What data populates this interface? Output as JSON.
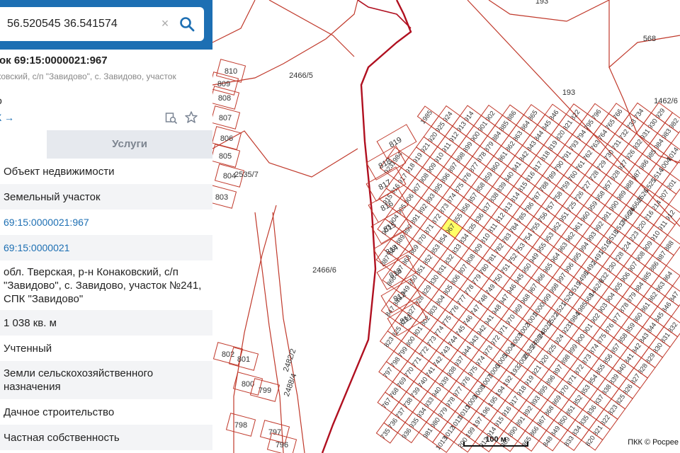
{
  "search": {
    "value": "56.520545 36.541574",
    "placeholder": "",
    "clear_glyph": "×",
    "icon": "search-icon"
  },
  "panel": {
    "title": "ок 69:15:0000021:967",
    "subtitle": "ковский, с/п \"Завидово\", с. Завидово, участок",
    "line3": "о",
    "link_label": "К →",
    "icons": [
      "document-search-icon",
      "star-icon"
    ],
    "collapse_glyph": "‹"
  },
  "tabs": {
    "info_label": "",
    "services_label": "Услуги"
  },
  "attributes": [
    "Объект недвижимости",
    "Земельный участок",
    "69:15:0000021:967",
    "69:15:0000021",
    "обл. Тверская, р-н Конаковский, с/п \"Завидово\", с. Завидово, участок №241, СПК \"Завидово\"",
    "1 038 кв. м",
    "Учтенный",
    "Земли сельскохозяйственного назначения",
    "Дачное строительство",
    "Частная собственность"
  ],
  "map": {
    "scale_label": "100 м",
    "attribution": "ПКК © Росрее",
    "parcel_line_color": "#c0392b",
    "border_color": "#b01020",
    "highlight_color": "#ffff66",
    "highlighted_parcel": "967",
    "parcel_labels": [
      "1985",
      "1984",
      "923",
      "924",
      "925",
      "920",
      "921",
      "919",
      "918",
      "917",
      "916",
      "915",
      "914",
      "913",
      "912",
      "911",
      "910",
      "909",
      "908",
      "907",
      "906",
      "905",
      "904",
      "903",
      "902",
      "901",
      "900",
      "899",
      "898",
      "897",
      "896",
      "895",
      "893",
      "892",
      "891",
      "890",
      "889",
      "888",
      "887",
      "886",
      "885",
      "884",
      "879",
      "878",
      "877",
      "876",
      "875",
      "874",
      "873",
      "872",
      "871",
      "870",
      "869",
      "868",
      "867",
      "866",
      "865",
      "864",
      "863",
      "862",
      "861",
      "860",
      "859",
      "858",
      "857",
      "856",
      "855",
      "854",
      "853",
      "852",
      "851",
      "850",
      "849",
      "848",
      "847",
      "846",
      "845",
      "844",
      "843",
      "842",
      "841",
      "840",
      "839",
      "838",
      "837",
      "836",
      "835",
      "834",
      "833",
      "832",
      "831",
      "830",
      "829",
      "828",
      "827",
      "826",
      "825",
      "823",
      "822",
      "821",
      "820",
      "819",
      "818",
      "817",
      "816",
      "815",
      "814",
      "813",
      "812",
      "811",
      "810",
      "809",
      "808",
      "807",
      "806",
      "805",
      "804",
      "803",
      "802",
      "801",
      "800",
      "799",
      "798",
      "797",
      "796",
      "795",
      "794",
      "793",
      "791",
      "790",
      "789",
      "788",
      "787",
      "786",
      "785",
      "784",
      "783",
      "782",
      "781",
      "780",
      "779",
      "778",
      "777",
      "776",
      "775",
      "774",
      "773",
      "772",
      "771",
      "770",
      "769",
      "768",
      "767",
      "766",
      "765",
      "764",
      "763",
      "762",
      "761",
      "760",
      "759",
      "758",
      "757",
      "756",
      "755",
      "754",
      "753",
      "752",
      "751",
      "750",
      "749",
      "748",
      "747",
      "746",
      "745",
      "744",
      "743",
      "742",
      "741",
      "740",
      "739",
      "738",
      "737",
      "736",
      "735",
      "734",
      "733",
      "732",
      "731",
      "730",
      "729",
      "728",
      "727",
      "726",
      "725",
      "951",
      "952",
      "953",
      "955",
      "949",
      "950",
      "945",
      "946",
      "947",
      "948",
      "941",
      "942",
      "943",
      "944",
      "937",
      "938",
      "939",
      "940",
      "933",
      "934",
      "935",
      "936",
      "929",
      "930",
      "931",
      "932",
      "926",
      "927",
      "928",
      "957",
      "958",
      "959",
      "960",
      "961",
      "962",
      "963",
      "964",
      "965",
      "966",
      "967",
      "968",
      "969",
      "970",
      "971",
      "972",
      "973",
      "974",
      "975",
      "976",
      "977",
      "978",
      "979",
      "980",
      "981",
      "982",
      "983",
      "984",
      "985",
      "986",
      "987",
      "988",
      "989",
      "990",
      "991",
      "992",
      "993",
      "994",
      "995",
      "996",
      "997",
      "998",
      "999",
      "1000",
      "1001",
      "1002",
      "1003",
      "1004",
      "1005",
      "1006",
      "1007",
      "1008",
      "1009",
      "1010",
      "1011",
      "1012",
      "1013",
      "1014",
      "2004",
      "2514",
      "2525",
      "2526",
      "2466/5",
      "2466/6",
      "2517",
      "2518",
      "2516",
      "2491",
      "2492",
      "2498",
      "2519",
      "2520",
      "2521",
      "2522",
      "2482/2",
      "2488/4",
      "2535/7",
      "2006",
      "193",
      "192",
      "194",
      "195",
      "196",
      "197",
      "199",
      "200",
      "201",
      "207",
      "214",
      "216",
      "220",
      "223",
      "224",
      "228",
      "230",
      "232",
      "1462/6",
      "568"
    ]
  }
}
